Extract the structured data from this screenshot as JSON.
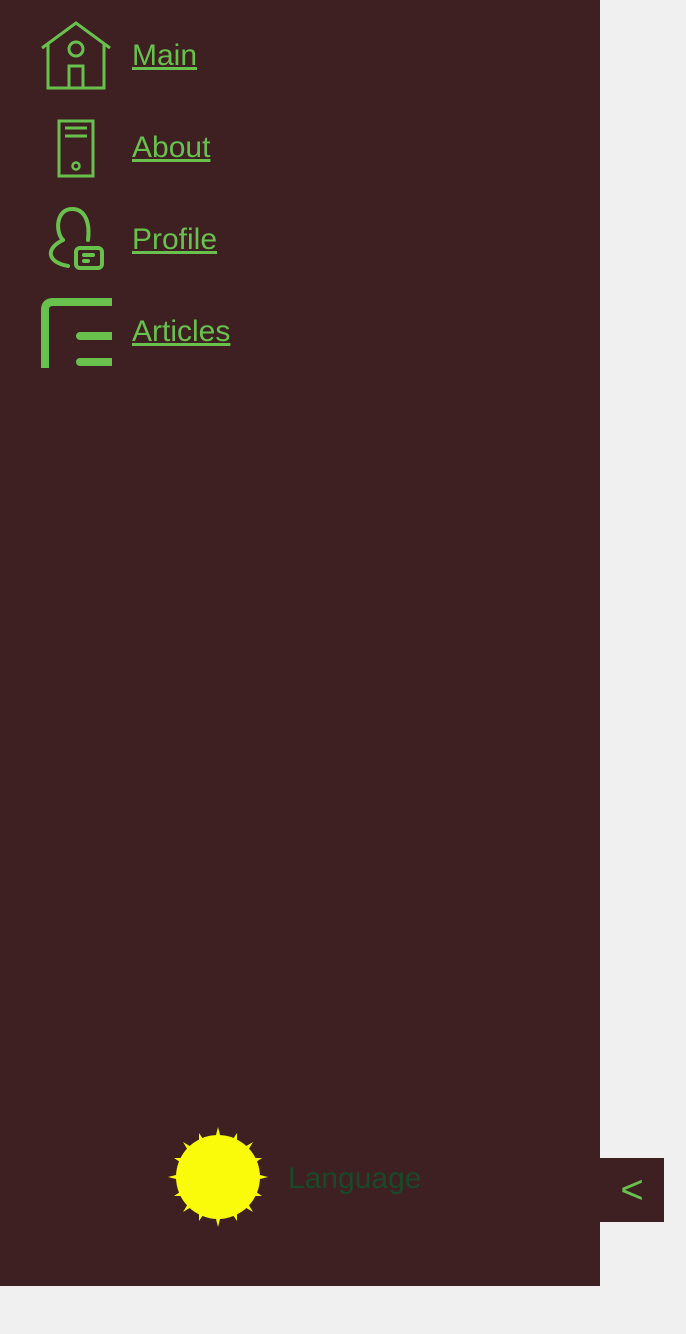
{
  "colors": {
    "sidebar_bg": "#3e2022",
    "page_bg": "#f0f0f0",
    "accent_green": "#67c14c",
    "language_text": "#19492a",
    "sun_yellow": "#f9fb0a"
  },
  "sidebar": {
    "items": [
      {
        "label": "Main",
        "icon": "home-icon"
      },
      {
        "label": "About",
        "icon": "document-icon"
      },
      {
        "label": "Profile",
        "icon": "user-card-icon"
      },
      {
        "label": "Articles",
        "icon": "list-icon"
      }
    ],
    "theme_toggle_icon": "sun-icon",
    "language_label": "Language",
    "collapse_label": "<"
  }
}
